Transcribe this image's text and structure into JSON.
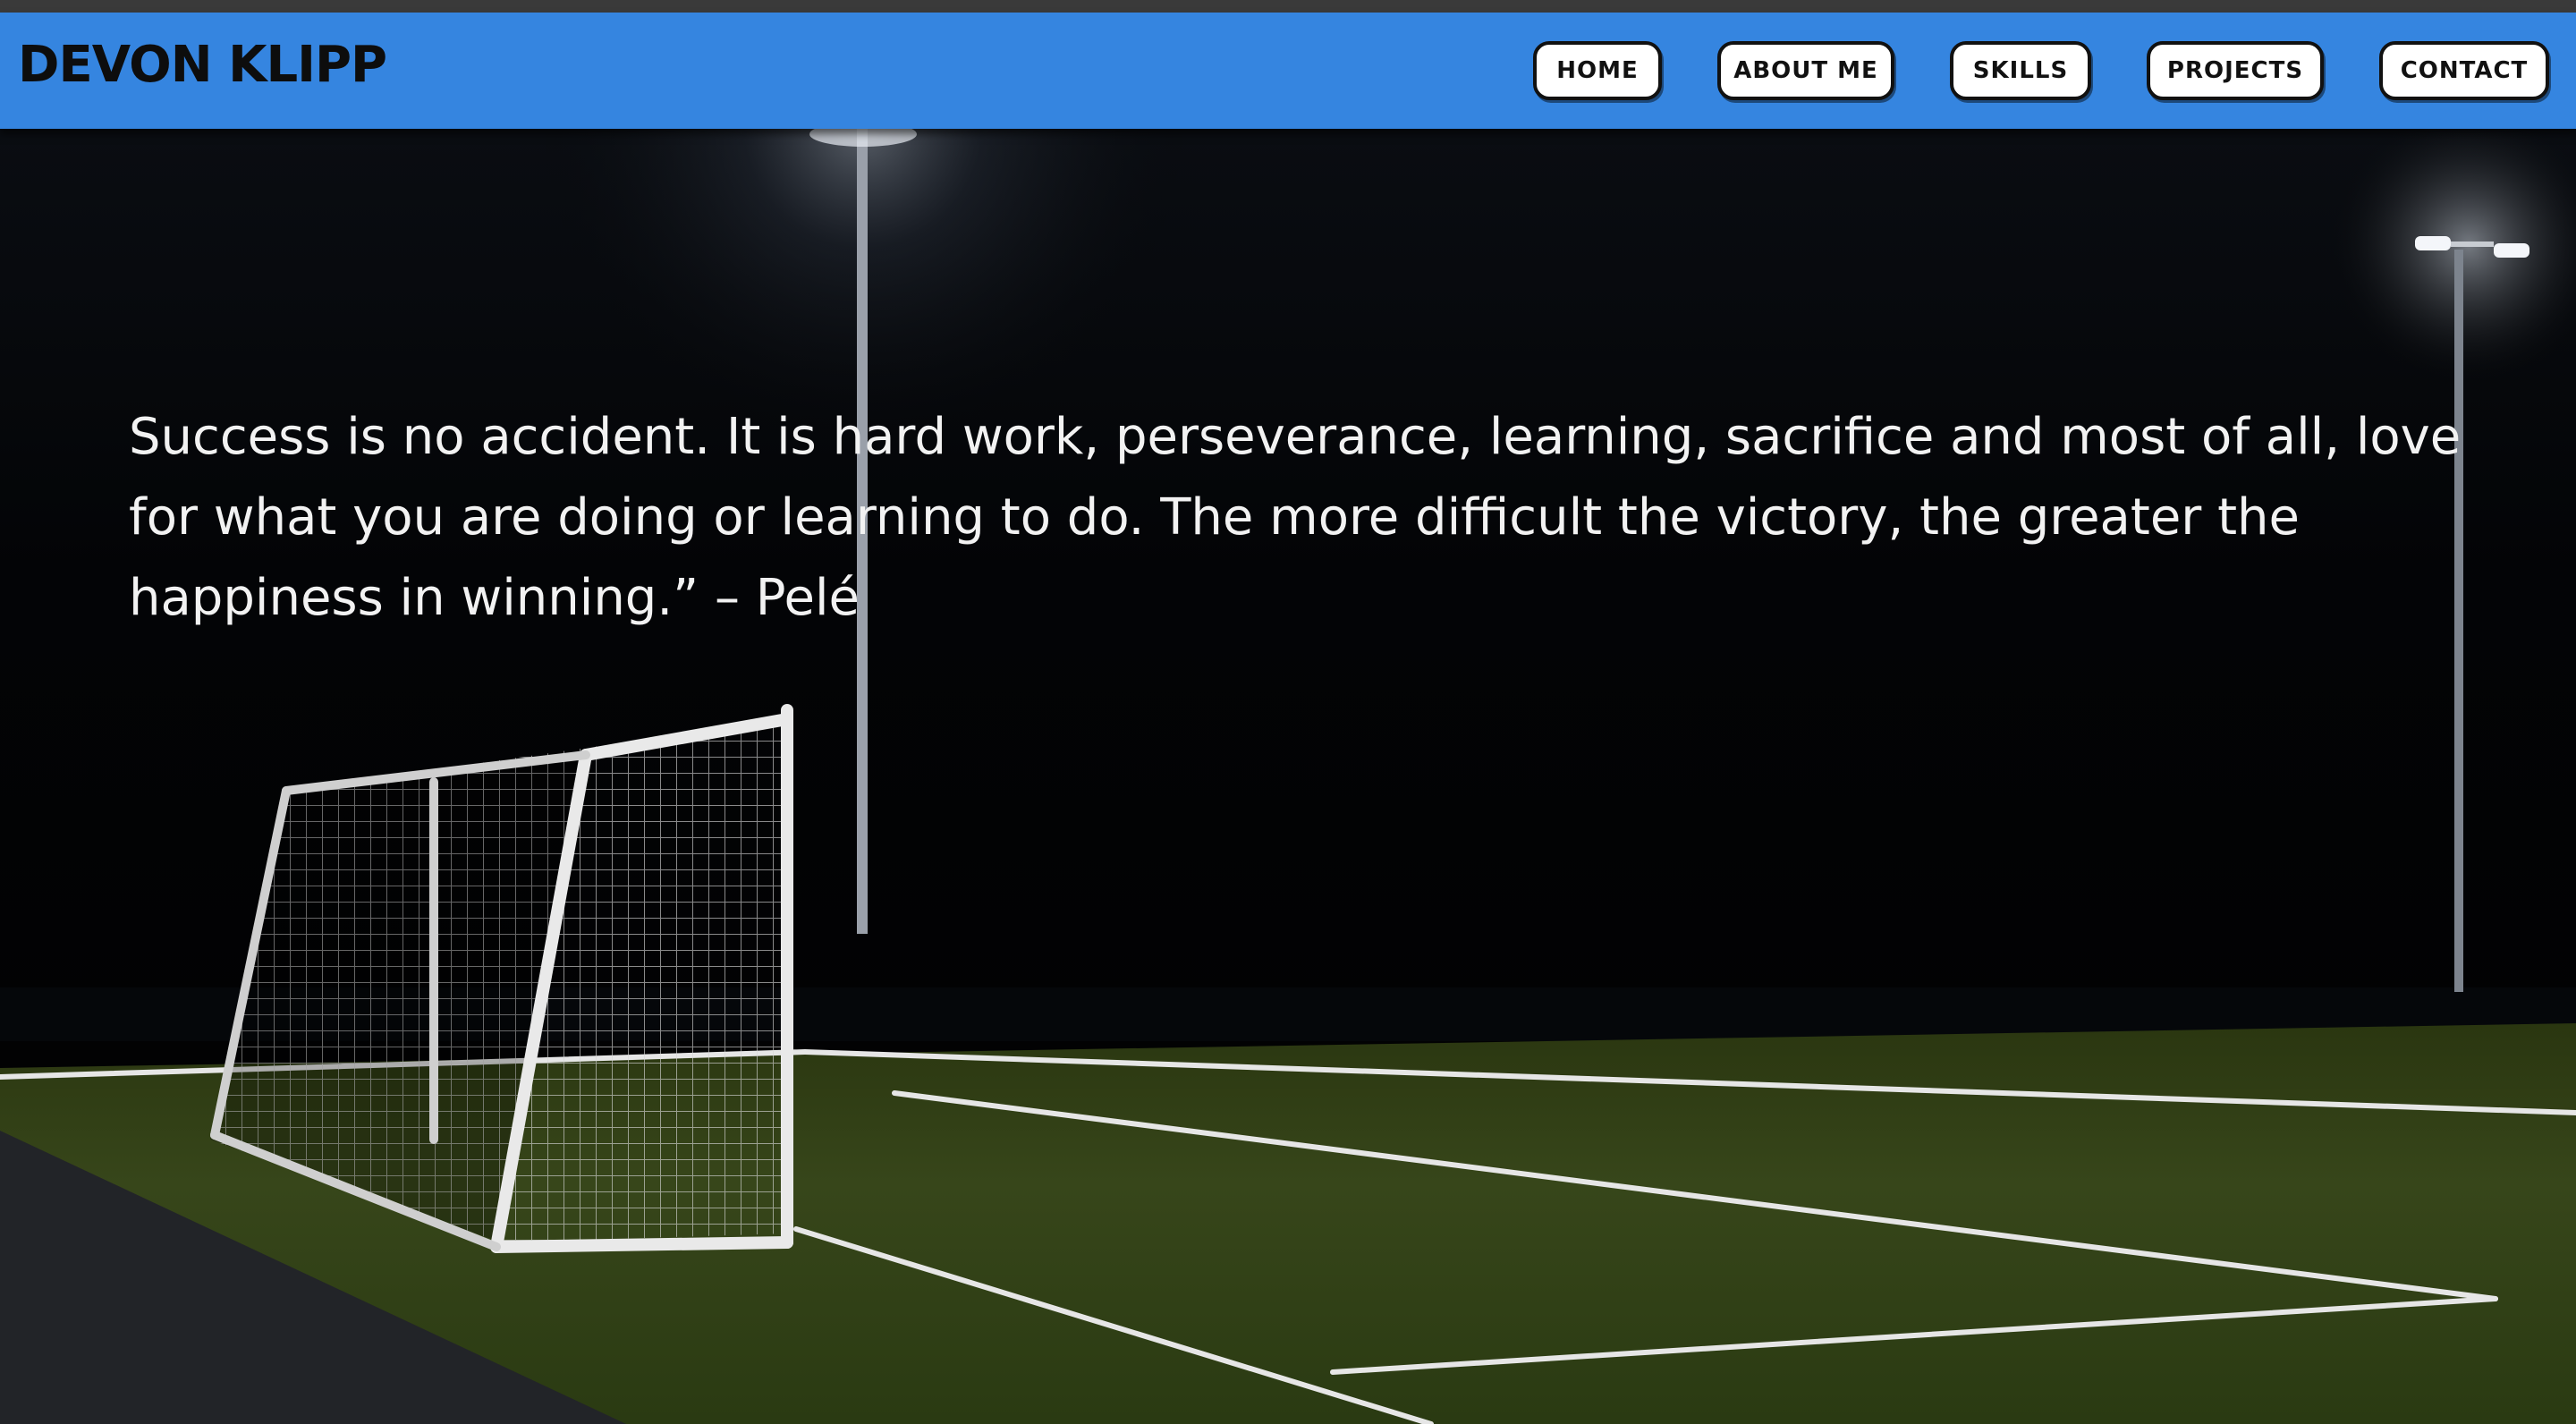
{
  "site": {
    "brand": "DEVON KLIPP",
    "nav": [
      {
        "label": "HOME"
      },
      {
        "label": "ABOUT ME"
      },
      {
        "label": "SKILLS"
      },
      {
        "label": "PROJECTS"
      },
      {
        "label": "CONTACT"
      }
    ]
  },
  "hero": {
    "quote": "Success is no accident. It is hard work, perseverance, learning, sacrifice and most of all, love for what you are doing or learning to do. The more difficult the victory, the greater the happiness in winning.” – Pelé",
    "background_image": "night-soccer-field-with-goal"
  },
  "colors": {
    "navbar": "#3585e0",
    "button_bg": "#ffffff",
    "button_border": "#111111",
    "text": "#f2f2f2",
    "grass": "#3a4a14"
  }
}
